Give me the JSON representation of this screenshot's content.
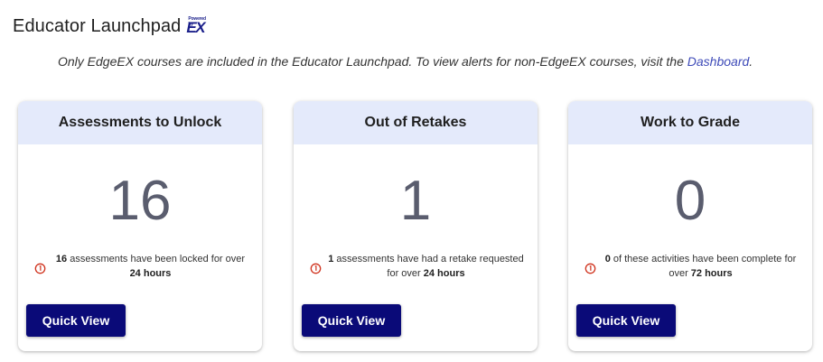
{
  "header": {
    "title": "Educator Launchpad",
    "logo_small_text": "Powered by",
    "logo_text": "EX",
    "logo_color": "#1a1f8a"
  },
  "info": {
    "text": "Only EdgeEX courses are included in the Educator Launchpad. To view alerts for non-EdgeEX courses, visit the ",
    "link_label": "Dashboard",
    "suffix": "."
  },
  "colors": {
    "card_header_bg": "#e4eafb",
    "button_bg": "#0a0a78",
    "alert_icon": "#d0321d",
    "count_color": "#5a5d6e",
    "link_color": "#3d4ab8"
  },
  "cards": [
    {
      "title": "Assessments to Unlock",
      "count": "16",
      "msg_bold1": "16",
      "msg_mid": " assessments have been locked for over ",
      "msg_bold2": "24 hours",
      "icon": "alert-clock-icon",
      "button_label": "Quick View"
    },
    {
      "title": "Out of Retakes",
      "count": "1",
      "msg_bold1": "1",
      "msg_mid": " assessments have had a retake requested for over ",
      "msg_bold2": "24 hours",
      "icon": "alert-clock-icon",
      "button_label": "Quick View"
    },
    {
      "title": "Work to Grade",
      "count": "0",
      "msg_bold1": "0",
      "msg_mid": " of these activities have been complete for over ",
      "msg_bold2": "72 hours",
      "icon": "alert-clock-icon",
      "button_label": "Quick View"
    }
  ]
}
